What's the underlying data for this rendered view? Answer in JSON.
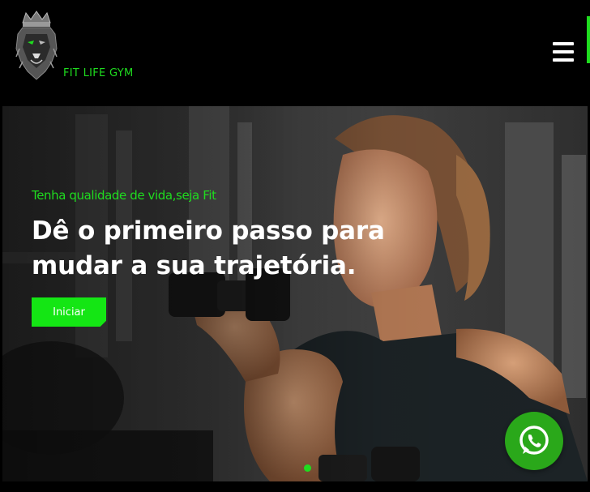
{
  "header": {
    "brand_name": "FIT LIFE GYM",
    "logo_icon": "lion-crown-logo-icon",
    "menu_icon": "hamburger-menu-icon"
  },
  "hero": {
    "eyebrow": "Tenha qualidade de vida,seja Fit",
    "headline_line1": "Dê o primeiro passo para",
    "headline_line2": "mudar a sua trajetória.",
    "cta_label": "Iniciar",
    "slide_count_visible": 1,
    "active_slide": 1
  },
  "floating": {
    "whatsapp_icon": "whatsapp-icon"
  },
  "colors": {
    "accent": "#1fdc1f",
    "button": "#14e614",
    "whatsapp": "#2aa81a",
    "background": "#000000",
    "headline": "#ffffff"
  }
}
